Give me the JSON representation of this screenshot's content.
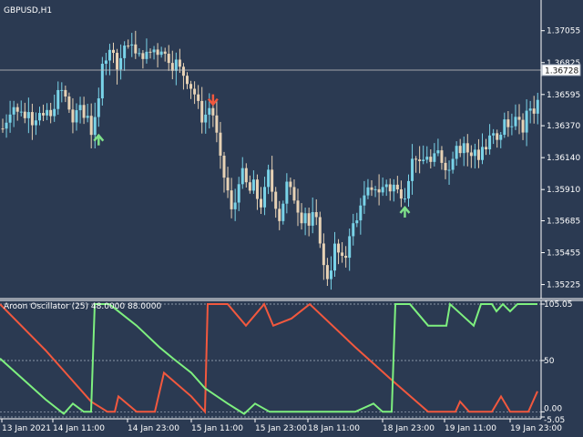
{
  "main_panel": {
    "title": "GBPUSD,H1",
    "price_ticks": [
      "1.37055",
      "1.36825",
      "1.36595",
      "1.36370",
      "1.36140",
      "1.35910",
      "1.35685",
      "1.35455",
      "1.35225"
    ],
    "current_price": "1.36728",
    "colors": {
      "bull": "#79d3e8",
      "bear": "#e7d2b5",
      "grid": "#41506a",
      "buy_arrow": "#7fe08a",
      "sell_arrow": "#f2583e"
    }
  },
  "sub_panel": {
    "title": "Aroon Oscillator (25) 48.0000 88.0000",
    "level_ticks": [
      "105.05",
      "50",
      "0.00",
      "-5.05"
    ],
    "colors": {
      "aroon_up": "#7ef07f",
      "aroon_down": "#f2583e"
    }
  },
  "time_axis": [
    "13 Jan 2021",
    "14 Jan 11:00",
    "14 Jan 23:00",
    "15 Jan 11:00",
    "15 Jan 23:00",
    "18 Jan 11:00",
    "18 Jan 23:00",
    "19 Jan 11:00",
    "19 Jan 23:00"
  ],
  "chart_data": [
    {
      "type": "candlestick",
      "title": "GBPUSD,H1",
      "ylim": [
        1.3515,
        1.3725
      ],
      "current_price": 1.36728,
      "close_path": [
        [
          0,
          1.3635
        ],
        [
          4,
          1.3641
        ],
        [
          8,
          1.3648
        ],
        [
          12,
          1.3651
        ],
        [
          16,
          1.3646
        ],
        [
          20,
          1.3649
        ],
        [
          24,
          1.3642
        ],
        [
          28,
          1.365
        ],
        [
          32,
          1.364
        ],
        [
          36,
          1.3643
        ],
        [
          40,
          1.3645
        ],
        [
          44,
          1.3641
        ],
        [
          48,
          1.3648
        ],
        [
          52,
          1.3642
        ],
        [
          56,
          1.3652
        ],
        [
          60,
          1.366
        ],
        [
          64,
          1.3662
        ],
        [
          68,
          1.3657
        ],
        [
          72,
          1.3649
        ],
        [
          76,
          1.364
        ],
        [
          80,
          1.3645
        ],
        [
          84,
          1.3652
        ],
        [
          88,
          1.3643
        ],
        [
          92,
          1.3646
        ],
        [
          96,
          1.3632
        ],
        [
          100,
          1.364
        ],
        [
          104,
          1.3655
        ],
        [
          108,
          1.3685
        ],
        [
          112,
          1.3686
        ],
        [
          116,
          1.369
        ],
        [
          120,
          1.3693
        ],
        [
          124,
          1.3678
        ],
        [
          128,
          1.3686
        ],
        [
          132,
          1.3695
        ],
        [
          136,
          1.3692
        ],
        [
          140,
          1.3698
        ],
        [
          144,
          1.3688
        ],
        [
          148,
          1.3687
        ],
        [
          152,
          1.3688
        ],
        [
          156,
          1.3688
        ],
        [
          160,
          1.369
        ],
        [
          164,
          1.3692
        ],
        [
          168,
          1.369
        ],
        [
          172,
          1.3693
        ],
        [
          176,
          1.3688
        ],
        [
          180,
          1.3685
        ],
        [
          184,
          1.368
        ],
        [
          188,
          1.3683
        ],
        [
          192,
          1.3678
        ],
        [
          196,
          1.3674
        ],
        [
          200,
          1.367
        ],
        [
          204,
          1.3665
        ],
        [
          208,
          1.366
        ],
        [
          212,
          1.3652
        ],
        [
          216,
          1.3642
        ],
        [
          220,
          1.3645
        ],
        [
          224,
          1.365
        ],
        [
          228,
          1.3645
        ],
        [
          232,
          1.363
        ],
        [
          236,
          1.3612
        ],
        [
          240,
          1.36
        ],
        [
          244,
          1.359
        ],
        [
          248,
          1.3575
        ],
        [
          252,
          1.3582
        ],
        [
          256,
          1.3598
        ],
        [
          260,
          1.3603
        ],
        [
          264,
          1.3595
        ],
        [
          268,
          1.359
        ],
        [
          272,
          1.3595
        ],
        [
          276,
          1.3585
        ],
        [
          280,
          1.358
        ],
        [
          284,
          1.359
        ],
        [
          288,
          1.3603
        ],
        [
          292,
          1.359
        ],
        [
          296,
          1.358
        ],
        [
          300,
          1.357
        ],
        [
          304,
          1.3582
        ],
        [
          308,
          1.3595
        ],
        [
          312,
          1.359
        ],
        [
          316,
          1.3585
        ],
        [
          320,
          1.3577
        ],
        [
          324,
          1.357
        ],
        [
          328,
          1.3575
        ],
        [
          332,
          1.3565
        ],
        [
          336,
          1.3572
        ],
        [
          340,
          1.3568
        ],
        [
          344,
          1.3555
        ],
        [
          348,
          1.3535
        ],
        [
          352,
          1.3528
        ],
        [
          356,
          1.3535
        ],
        [
          360,
          1.355
        ],
        [
          364,
          1.3545
        ],
        [
          368,
          1.354
        ],
        [
          372,
          1.3543
        ],
        [
          376,
          1.356
        ],
        [
          380,
          1.3565
        ],
        [
          384,
          1.3568
        ],
        [
          388,
          1.3582
        ],
        [
          392,
          1.3585
        ],
        [
          396,
          1.359
        ],
        [
          400,
          1.3588
        ],
        [
          404,
          1.3593
        ],
        [
          408,
          1.359
        ],
        [
          412,
          1.3592
        ],
        [
          416,
          1.3595
        ],
        [
          420,
          1.3591
        ],
        [
          424,
          1.3594
        ],
        [
          428,
          1.359
        ],
        [
          432,
          1.3588
        ],
        [
          436,
          1.3588
        ],
        [
          440,
          1.36
        ],
        [
          444,
          1.3612
        ],
        [
          448,
          1.3615
        ],
        [
          452,
          1.3608
        ],
        [
          456,
          1.3612
        ],
        [
          460,
          1.3616
        ],
        [
          464,
          1.361
        ],
        [
          468,
          1.3614
        ],
        [
          472,
          1.3618
        ],
        [
          476,
          1.3612
        ],
        [
          480,
          1.3608
        ],
        [
          484,
          1.3605
        ],
        [
          488,
          1.3616
        ],
        [
          492,
          1.3625
        ],
        [
          496,
          1.362
        ],
        [
          500,
          1.3625
        ],
        [
          504,
          1.3618
        ],
        [
          508,
          1.3614
        ],
        [
          512,
          1.362
        ],
        [
          516,
          1.3614
        ],
        [
          520,
          1.3622
        ],
        [
          524,
          1.362
        ],
        [
          528,
          1.3628
        ],
        [
          532,
          1.363
        ],
        [
          536,
          1.3625
        ],
        [
          540,
          1.3632
        ],
        [
          544,
          1.364
        ],
        [
          548,
          1.3636
        ],
        [
          552,
          1.364
        ],
        [
          556,
          1.3642
        ],
        [
          560,
          1.3638
        ],
        [
          564,
          1.3634
        ],
        [
          568,
          1.3645
        ],
        [
          572,
          1.365
        ],
        [
          576,
          1.3648
        ],
        [
          580,
          1.3655
        ],
        [
          584,
          1.3658
        ],
        [
          588,
          1.3668
        ]
      ],
      "signals": [
        {
          "type": "buy",
          "x_candle": 26,
          "price": 1.3632
        },
        {
          "type": "sell",
          "x_candle": 57,
          "price": 1.3657
        },
        {
          "type": "buy",
          "x_candle": 109,
          "price": 1.358
        }
      ]
    },
    {
      "type": "line",
      "title": "Aroon Oscillator (25) 48.0000 88.0000",
      "ylim": [
        -5.05,
        105.05
      ],
      "series": [
        {
          "name": "aroon-up",
          "color": "#7ef07f",
          "points": [
            [
              0,
              52
            ],
            [
              25,
              32
            ],
            [
              50,
              12
            ],
            [
              70,
              -2
            ],
            [
              80,
              8
            ],
            [
              92,
              0
            ],
            [
              100,
              0
            ],
            [
              104,
              105
            ],
            [
              120,
              105
            ],
            [
              150,
              84
            ],
            [
              175,
              63
            ],
            [
              190,
              52
            ],
            [
              210,
              38
            ],
            [
              225,
              23
            ],
            [
              250,
              8
            ],
            [
              268,
              -2
            ],
            [
              280,
              8
            ],
            [
              296,
              0
            ],
            [
              340,
              0
            ],
            [
              390,
              0
            ],
            [
              410,
              8
            ],
            [
              420,
              0
            ],
            [
              430,
              0
            ],
            [
              434,
              105
            ],
            [
              450,
              105
            ],
            [
              470,
              84
            ],
            [
              490,
              84
            ],
            [
              494,
              105
            ],
            [
              520,
              84
            ],
            [
              528,
              105
            ],
            [
              540,
              105
            ],
            [
              545,
              98
            ],
            [
              552,
              105
            ],
            [
              560,
              98
            ],
            [
              568,
              105
            ],
            [
              590,
              105
            ]
          ]
        },
        {
          "name": "aroon-down",
          "color": "#f2583e",
          "points": [
            [
              0,
              105
            ],
            [
              50,
              60
            ],
            [
              75,
              35
            ],
            [
              100,
              10
            ],
            [
              118,
              0
            ],
            [
              126,
              0
            ],
            [
              130,
              15
            ],
            [
              150,
              0
            ],
            [
              170,
              0
            ],
            [
              180,
              38
            ],
            [
              210,
              15
            ],
            [
              225,
              0
            ],
            [
              228,
              105
            ],
            [
              250,
              105
            ],
            [
              270,
              84
            ],
            [
              290,
              105
            ],
            [
              300,
              84
            ],
            [
              320,
              91
            ],
            [
              340,
              105
            ],
            [
              390,
              63
            ],
            [
              430,
              31
            ],
            [
              470,
              0
            ],
            [
              500,
              0
            ],
            [
              505,
              10
            ],
            [
              515,
              0
            ],
            [
              540,
              0
            ],
            [
              550,
              15
            ],
            [
              560,
              0
            ],
            [
              580,
              0
            ],
            [
              590,
              20
            ]
          ]
        }
      ],
      "levels": [
        105.05,
        50,
        0.0,
        -5.05
      ]
    }
  ]
}
